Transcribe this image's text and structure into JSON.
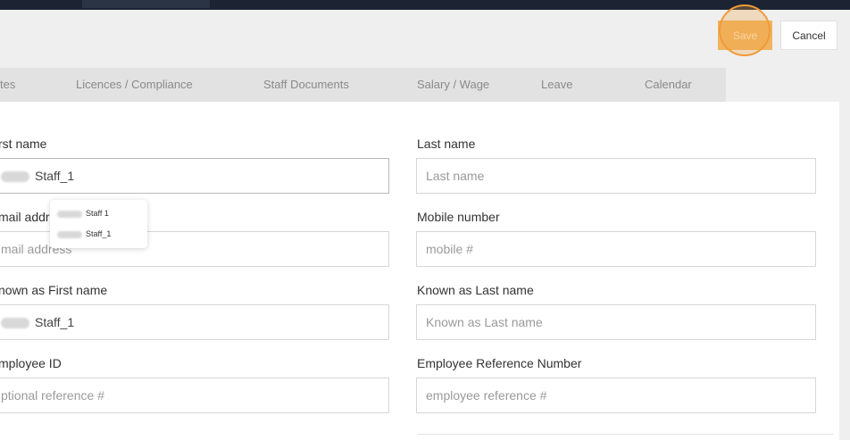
{
  "actions": {
    "save_label": "Save",
    "cancel_label": "Cancel"
  },
  "tabs": [
    "tes",
    "Licences / Compliance",
    "Staff Documents",
    "Salary / Wage",
    "Leave",
    "Calendar"
  ],
  "form": {
    "first_name": {
      "label": "rst name",
      "value": "Staff_1"
    },
    "last_name": {
      "label": "Last name",
      "placeholder": "Last name"
    },
    "email": {
      "label": "mail addr",
      "placeholder": "mail address"
    },
    "mobile": {
      "label": "Mobile number",
      "placeholder": "mobile #"
    },
    "known_first": {
      "label": "nown as First name",
      "value": "Staff_1"
    },
    "known_last": {
      "label": "Known as Last name",
      "placeholder": "Known as Last name"
    },
    "employee_id": {
      "label": "mployee ID",
      "placeholder": "ptional reference #"
    },
    "employee_ref": {
      "label": "Employee Reference Number",
      "placeholder": "employee reference #"
    }
  },
  "autocomplete": [
    "Staff 1",
    "Staff_1"
  ]
}
